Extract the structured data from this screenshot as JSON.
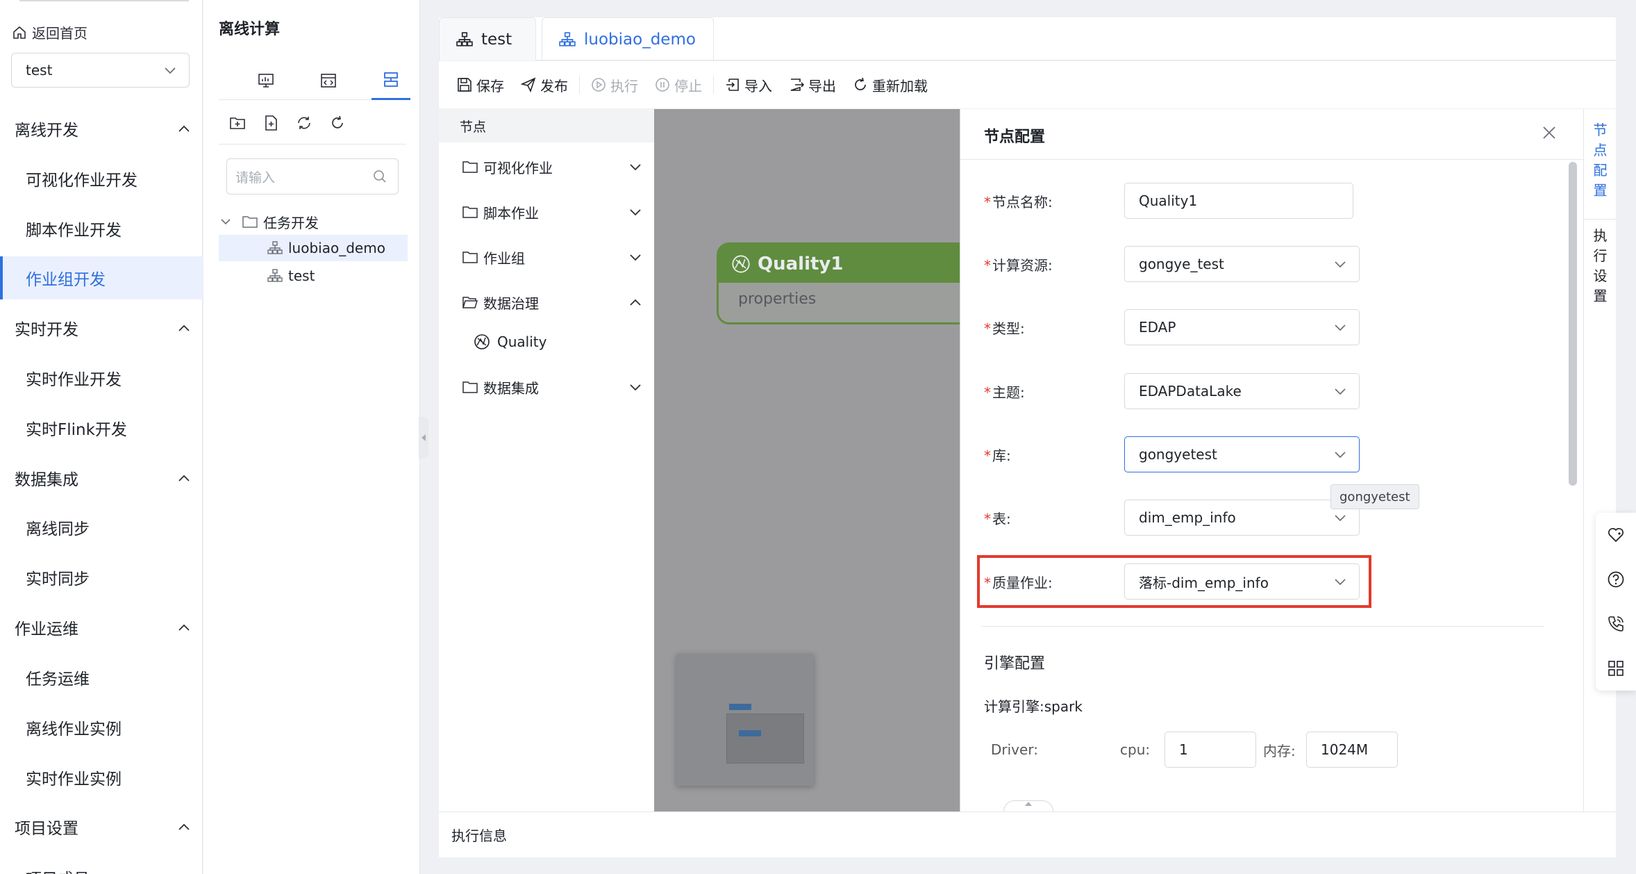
{
  "nav": {
    "home_label": "返回首页",
    "project": "test",
    "groups": [
      {
        "label": "离线开发",
        "items": [
          "可视化作业开发",
          "脚本作业开发",
          "作业组开发"
        ]
      },
      {
        "label": "实时开发",
        "items": [
          "实时作业开发",
          "实时Flink开发"
        ]
      },
      {
        "label": "数据集成",
        "items": [
          "离线同步",
          "实时同步"
        ]
      },
      {
        "label": "作业运维",
        "items": [
          "任务运维",
          "离线作业实例",
          "实时作业实例"
        ]
      },
      {
        "label": "项目设置",
        "items": [
          "项目成员"
        ]
      }
    ],
    "active_item": "作业组开发"
  },
  "tree": {
    "title": "离线计算",
    "search_placeholder": "请输入",
    "folder": "任务开发",
    "files": [
      "luobiao_demo",
      "test"
    ],
    "selected_file": "luobiao_demo"
  },
  "tabs": [
    {
      "label": "test",
      "active": false
    },
    {
      "label": "luobiao_demo",
      "active": true
    }
  ],
  "toolbar": {
    "save": "保存",
    "publish": "发布",
    "run": "执行",
    "stop": "停止",
    "import": "导入",
    "export": "导出",
    "reload": "重新加载"
  },
  "palette": {
    "header": "节点",
    "categories": [
      "可视化作业",
      "脚本作业",
      "作业组",
      "数据治理",
      "数据集成"
    ],
    "expanded_child": "Quality"
  },
  "canvas": {
    "node_title": "Quality1",
    "node_sub": "properties"
  },
  "drawer": {
    "title": "节点配置",
    "fields": {
      "name": {
        "label": "节点名称:",
        "value": "Quality1"
      },
      "resource": {
        "label": "计算资源:",
        "value": "gongye_test"
      },
      "type": {
        "label": "类型:",
        "value": "EDAP"
      },
      "topic": {
        "label": "主题:",
        "value": "EDAPDataLake"
      },
      "db": {
        "label": "库:",
        "value": "gongyetest"
      },
      "table": {
        "label": "表:",
        "value": "dim_emp_info"
      },
      "quality_job": {
        "label": "质量作业:",
        "value": "落标-dim_emp_info"
      }
    },
    "tooltip": "gongyetest",
    "engine_section": "引擎配置",
    "engine_label": "计算引擎:",
    "engine_value": "spark",
    "driver_label": "Driver:",
    "cpu_label": "cpu:",
    "cpu_value": "1",
    "mem_label": "内存:",
    "mem_value": "1024M"
  },
  "vtabs": [
    "节点配置",
    "执行设置"
  ],
  "exec_info": "执行信息",
  "colors": {
    "accent": "#2f6fe0",
    "node_green": "#5f8c3e",
    "highlight": "#e23a2e"
  }
}
